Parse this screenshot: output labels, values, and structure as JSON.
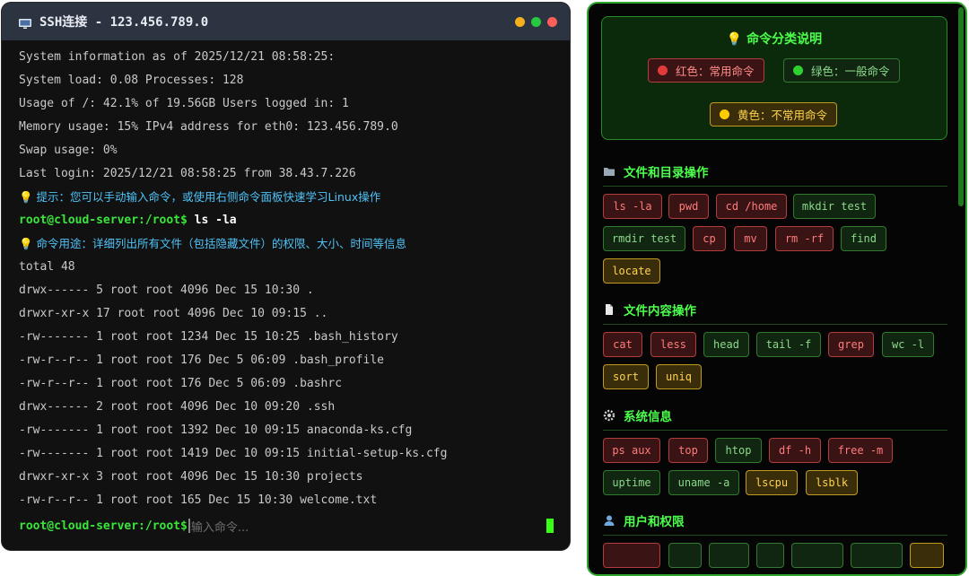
{
  "terminal": {
    "title": "SSH连接 - 123.456.789.0",
    "lines": [
      "System information as of 2025/12/21 08:58:25:",
      "System load: 0.08 Processes: 128",
      "Usage of /: 42.1% of 19.56GB Users logged in: 1",
      "Memory usage: 15% IPv4 address for eth0: 123.456.789.0",
      "Swap usage: 0%",
      "Last login: 2025/12/21 08:58:25 from 38.43.7.226"
    ],
    "tip1": "💡 提示：您可以手动输入命令，或使用右侧命令面板快速学习Linux操作",
    "prompt": "root@cloud-server:/root$",
    "command": " ls -la",
    "tip2": "💡 命令用途：详细列出所有文件（包括隐藏文件）的权限、大小、时间等信息",
    "output": [
      "total 48",
      "drwx------ 5 root root 4096 Dec 15 10:30 .",
      "drwxr-xr-x 17 root root 4096 Dec 10 09:15 ..",
      "-rw------- 1 root root 1234 Dec 15 10:25 .bash_history",
      "-rw-r--r-- 1 root root 176 Dec 5 06:09 .bash_profile",
      "-rw-r--r-- 1 root root 176 Dec 5 06:09 .bashrc",
      "drwx------ 2 root root 4096 Dec 10 09:20 .ssh",
      "-rw------- 1 root root 1392 Dec 10 09:15 anaconda-ks.cfg",
      "-rw------- 1 root root 1419 Dec 10 09:15 initial-setup-ks.cfg",
      "drwxr-xr-x 3 root root 4096 Dec 15 10:30 projects",
      "-rw-r--r-- 1 root root 165 Dec 15 10:30 welcome.txt"
    ],
    "input_prompt": "root@cloud-server:/root$",
    "input_placeholder": "输入命令..."
  },
  "colors": {
    "red": "#e23b3b",
    "green": "#2ed12e",
    "yellow": "#ffcc00",
    "accent": "#39e639"
  },
  "panel": {
    "legend": {
      "title": "💡 命令分类说明",
      "red": "红色：常用命令",
      "green": "绿色：一般命令",
      "yellow": "黄色：不常用命令"
    },
    "sections": [
      {
        "title": "文件和目录操作",
        "icon": "folder-icon",
        "chips": [
          {
            "label": "ls -la",
            "level": "red"
          },
          {
            "label": "pwd",
            "level": "red"
          },
          {
            "label": "cd /home",
            "level": "red"
          },
          {
            "label": "mkdir test",
            "level": "green"
          },
          {
            "label": "rmdir test",
            "level": "green"
          },
          {
            "label": "cp",
            "level": "red"
          },
          {
            "label": "mv",
            "level": "red"
          },
          {
            "label": "rm -rf",
            "level": "red"
          },
          {
            "label": "find",
            "level": "green"
          },
          {
            "label": "locate",
            "level": "yellow"
          }
        ]
      },
      {
        "title": "文件内容操作",
        "icon": "document-icon",
        "chips": [
          {
            "label": "cat",
            "level": "red"
          },
          {
            "label": "less",
            "level": "red"
          },
          {
            "label": "head",
            "level": "green"
          },
          {
            "label": "tail -f",
            "level": "green"
          },
          {
            "label": "grep",
            "level": "red"
          },
          {
            "label": "wc -l",
            "level": "green"
          },
          {
            "label": "sort",
            "level": "yellow"
          },
          {
            "label": "uniq",
            "level": "yellow"
          }
        ]
      },
      {
        "title": "系统信息",
        "icon": "gear-icon",
        "chips": [
          {
            "label": "ps aux",
            "level": "red"
          },
          {
            "label": "top",
            "level": "red"
          },
          {
            "label": "htop",
            "level": "green"
          },
          {
            "label": "df -h",
            "level": "red"
          },
          {
            "label": "free -m",
            "level": "red"
          },
          {
            "label": "uptime",
            "level": "green"
          },
          {
            "label": "uname -a",
            "level": "green"
          },
          {
            "label": "lscpu",
            "level": "yellow"
          },
          {
            "label": "lsblk",
            "level": "yellow"
          }
        ]
      },
      {
        "title": "用户和权限",
        "icon": "user-icon",
        "chips": []
      }
    ]
  }
}
